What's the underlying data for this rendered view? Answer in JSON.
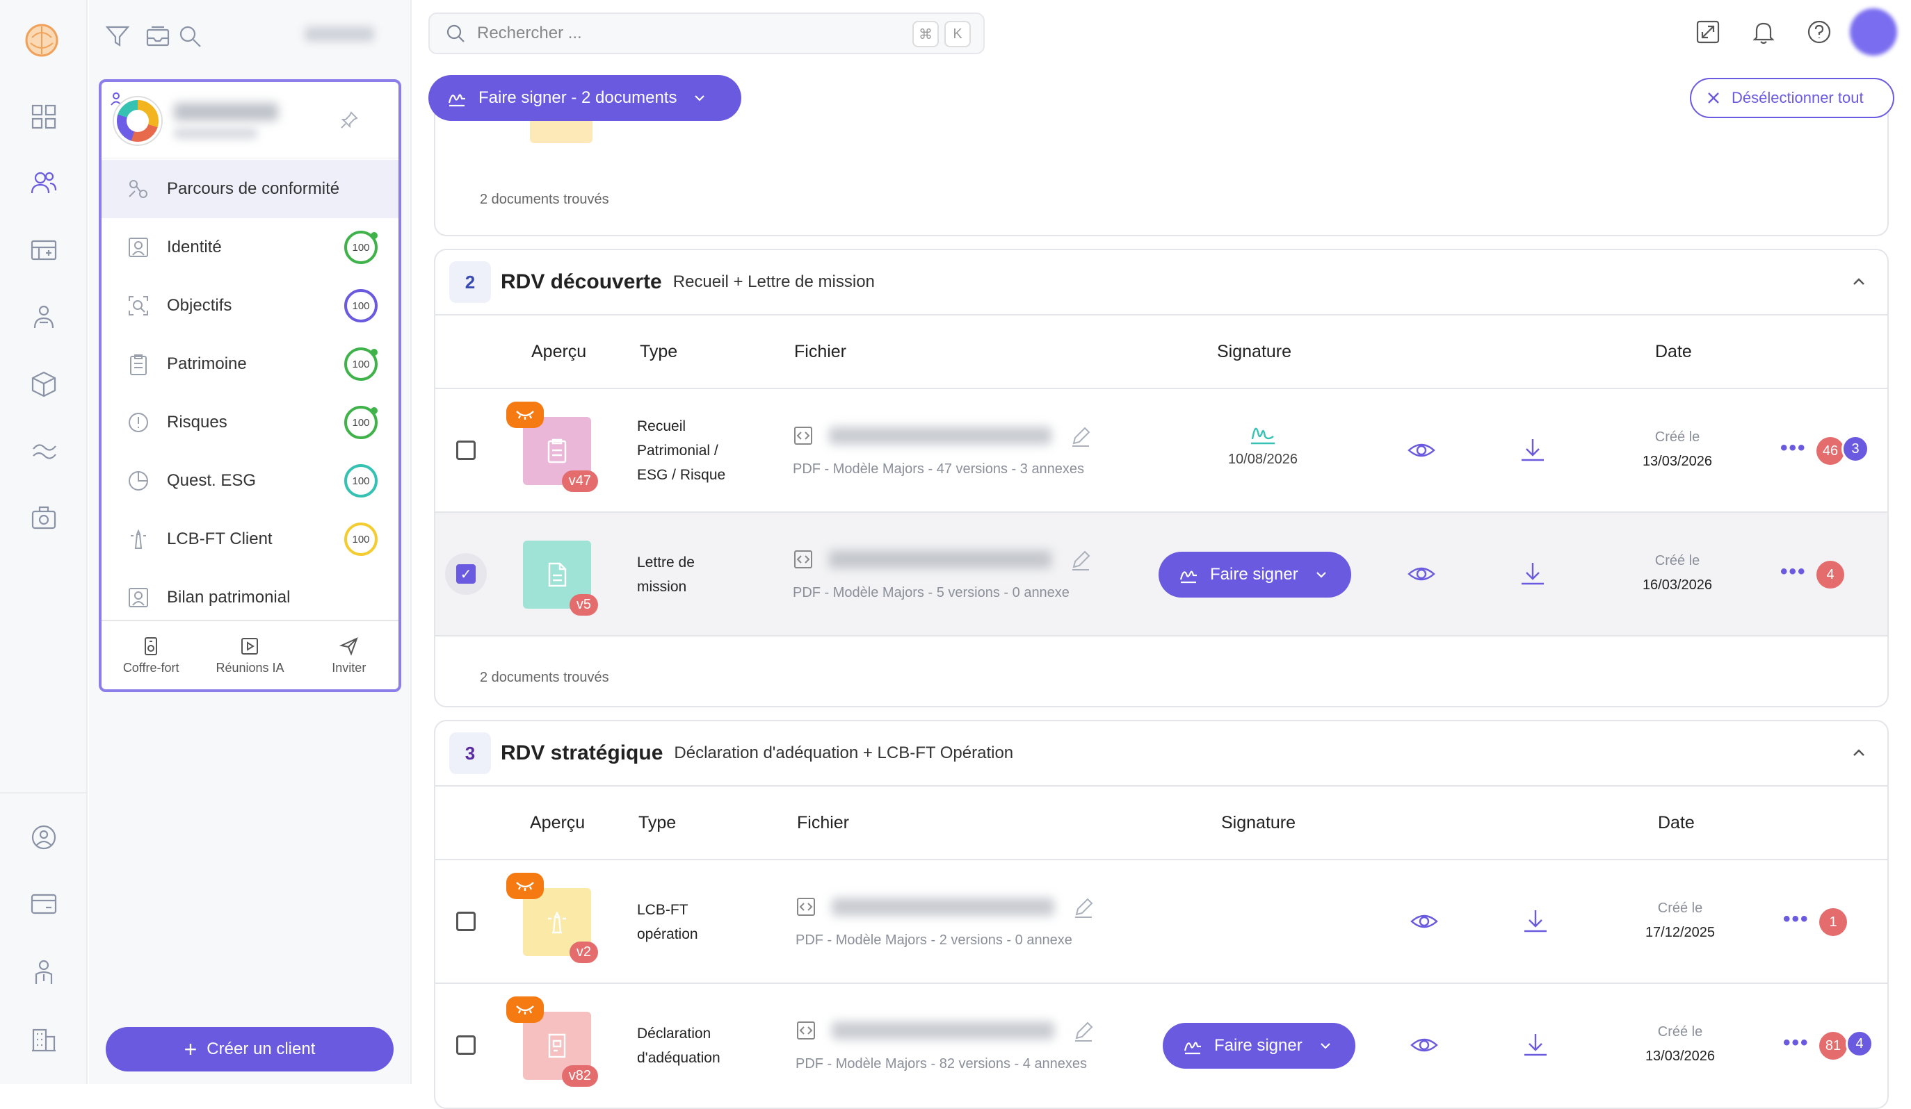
{
  "search": {
    "placeholder": "Rechercher ...",
    "kbd1": "⌘",
    "kbd2": "K"
  },
  "top_actions": {
    "sign_button": "Faire signer - 2 documents",
    "deselect": "Désélectionner tout"
  },
  "client_card": {
    "nav": [
      {
        "label": "Parcours de conformité",
        "score": null
      },
      {
        "label": "Identité",
        "score": "100",
        "color": "green"
      },
      {
        "label": "Objectifs",
        "score": "100",
        "color": "purple"
      },
      {
        "label": "Patrimoine",
        "score": "100",
        "color": "green"
      },
      {
        "label": "Risques",
        "score": "100",
        "color": "green"
      },
      {
        "label": "Quest. ESG",
        "score": "100",
        "color": "teal"
      },
      {
        "label": "LCB-FT Client",
        "score": "100",
        "color": "yellow"
      },
      {
        "label": "Bilan patrimonial",
        "score": null
      }
    ],
    "footer": [
      "Coffre-fort",
      "Réunions IA",
      "Inviter"
    ]
  },
  "create_client": "Créer un client",
  "section0": {
    "found": "2 documents trouvés"
  },
  "section1": {
    "number": "2",
    "title": "RDV découverte",
    "subtitle": "Recueil + Lettre de mission",
    "headers": [
      "Aperçu",
      "Type",
      "Fichier",
      "Signature",
      "Date"
    ],
    "rows": [
      {
        "type": "Recueil Patrimonial / ESG / Risque",
        "type_lines": [
          "Recueil",
          "Patrimonial /",
          "ESG / Risque"
        ],
        "version": "v47",
        "meta": "PDF - Modèle Majors - 47 versions - 3 annexes",
        "signature_date": "10/08/2026",
        "date_label": "Créé le",
        "date": "13/03/2026",
        "badge1": "46",
        "badge2": "3",
        "selected": false
      },
      {
        "type": "Lettre de mission",
        "type_lines": [
          "Lettre de",
          "mission"
        ],
        "version": "v5",
        "meta": "PDF - Modèle Majors - 5 versions - 0 annexe",
        "sign_button": "Faire signer",
        "date_label": "Créé le",
        "date": "16/03/2026",
        "badge1": "4",
        "selected": true
      }
    ],
    "found": "2 documents trouvés"
  },
  "section2": {
    "number": "3",
    "title": "RDV stratégique",
    "subtitle": "Déclaration d'adéquation + LCB-FT Opération",
    "headers": [
      "Aperçu",
      "Type",
      "Fichier",
      "Signature",
      "Date"
    ],
    "rows": [
      {
        "type_lines": [
          "LCB-FT",
          "opération"
        ],
        "version": "v2",
        "meta": "PDF - Modèle Majors - 2 versions - 0 annexe",
        "date_label": "Créé le",
        "date": "17/12/2025",
        "badge1": "1"
      },
      {
        "type_lines": [
          "Déclaration",
          "d'adéquation"
        ],
        "version": "v82",
        "meta": "PDF - Modèle Majors - 82 versions - 4 annexes",
        "sign_button": "Faire signer",
        "date_label": "Créé le",
        "date": "13/03/2026",
        "badge1": "81",
        "badge2": "4"
      }
    ]
  },
  "colors": {
    "accent": "#6a5ae0",
    "teal": "#36c2b2",
    "orange": "#f57a12",
    "red_badge": "#e46c6c"
  }
}
